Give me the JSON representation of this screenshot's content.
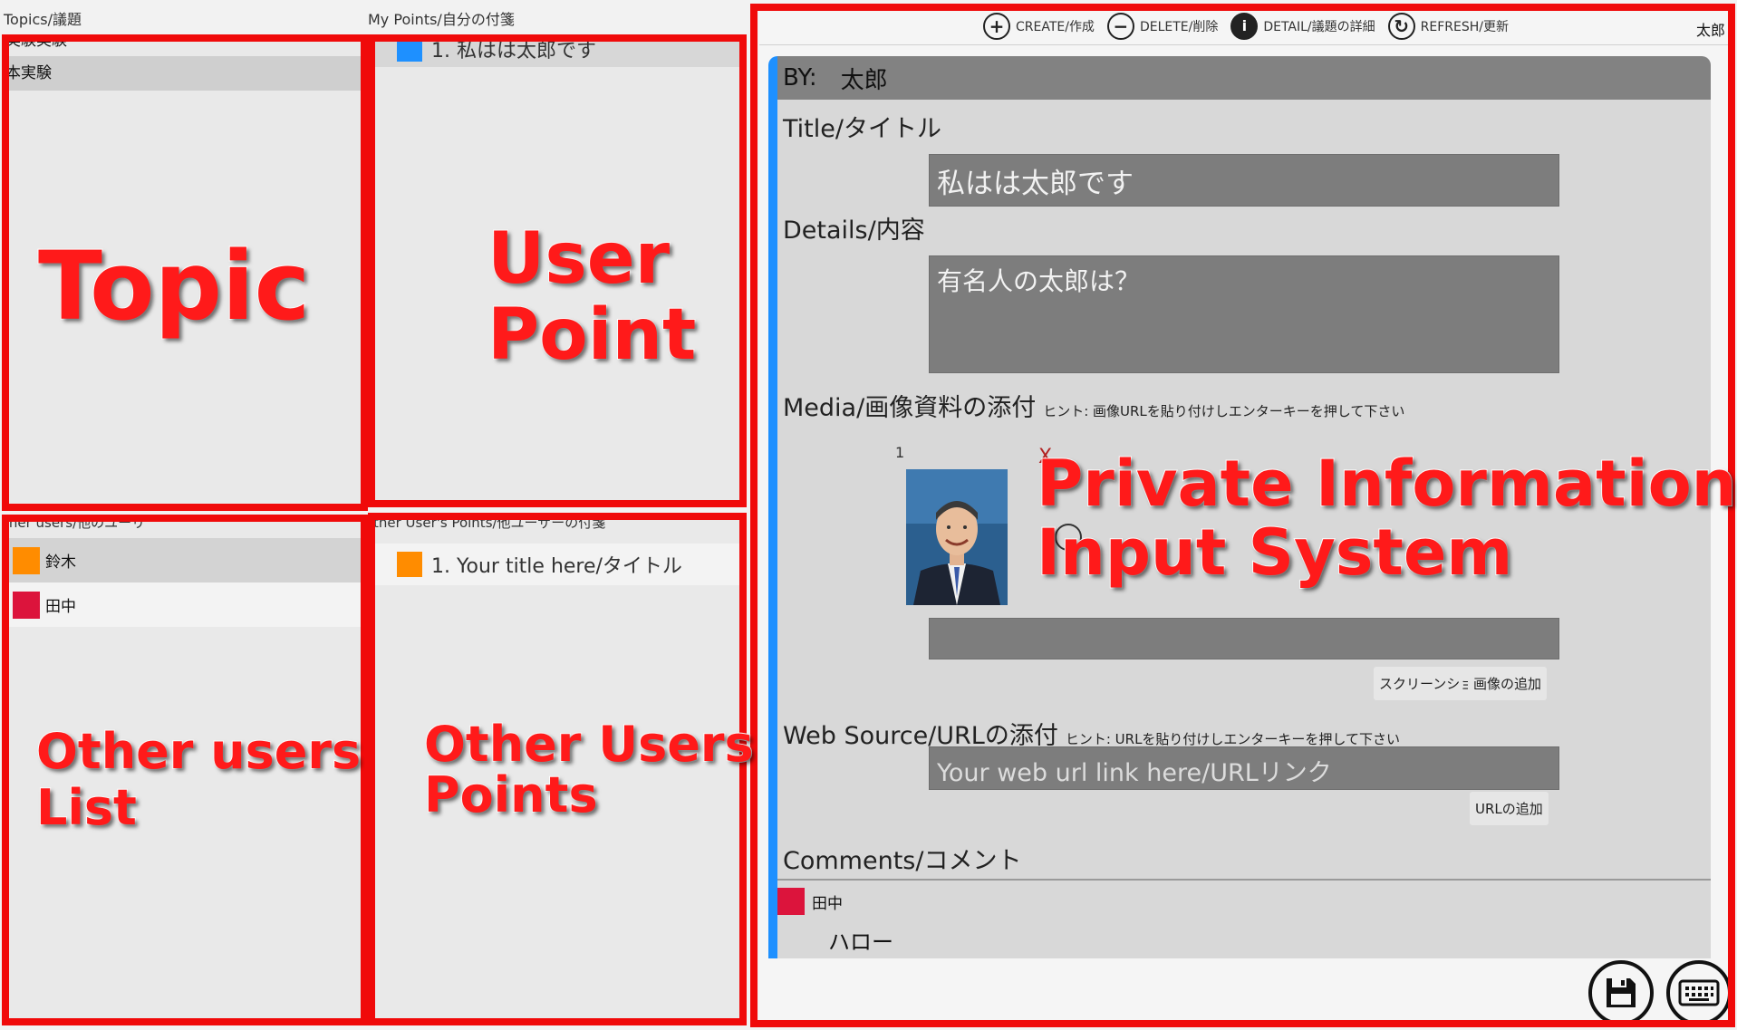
{
  "columns": {
    "topics_header": "Topics/議題",
    "my_points_header": "My Points/自分の付箋",
    "other_users_header": "ther users/他のユーリ",
    "other_points_header": "ther User's Points/他ユーザーの付箋"
  },
  "topics": [
    {
      "label": "実験実験"
    },
    {
      "label": "本実験"
    }
  ],
  "my_points": [
    {
      "label": "1. 私はは太郎です",
      "color": "#1e90ff"
    }
  ],
  "other_users": [
    {
      "name": "鈴木",
      "color": "#ff8c00"
    },
    {
      "name": "田中",
      "color": "#dc143c"
    }
  ],
  "other_points": [
    {
      "label": "1. Your title here/タイトル",
      "color": "#ff8c00"
    }
  ],
  "annotations": {
    "topic": "Topic",
    "user_point_1": "User",
    "user_point_2": "Point",
    "other_users_1": "Other users",
    "other_users_2": "List",
    "other_points_1": "Other Users",
    "other_points_2": "Points",
    "private_1": "Private Information",
    "private_2": "Input System",
    "box_color": "#f00a0a"
  },
  "toolbar": {
    "create": "CREATE/作成",
    "delete": "DELETE/削除",
    "detail": "DETAIL/議題の詳細",
    "refresh": "REFRESH/更新",
    "current_user": "太郎",
    "create_icon": "+",
    "delete_icon": "−",
    "detail_icon": "i",
    "refresh_icon": "↻"
  },
  "detail": {
    "by_label": "BY:",
    "by_name": "太郎",
    "title_label": "Title/タイトル",
    "title_value": "私はは太郎です",
    "details_label": "Details/内容",
    "details_value": "有名人の太郎は？",
    "media_label": "Media/画像資料の添付",
    "media_hint": "ヒント: 画像URLを貼り付けしエンターキーを押して下さい",
    "media_index": "1",
    "media_remove": "X",
    "media_caption_value": "",
    "screenshot_button": "スクリーンショット",
    "add_image_button": "画像の追加",
    "web_label": "Web Source/URLの添付",
    "web_hint": "ヒント: URLを貼り付けしエンターキーを押して下さい",
    "web_placeholder": "Your web url link here/URLリンク",
    "add_url_button": "URLの追加",
    "comments_label": "Comments/コメント",
    "comment_author": "田中",
    "comment_author_color": "#dc143c",
    "comment_text": "ハロー"
  },
  "colors": {
    "accent": "#1e90ff",
    "pane_bg": "#e9e9e9",
    "field_bg": "#7d7d7d"
  }
}
